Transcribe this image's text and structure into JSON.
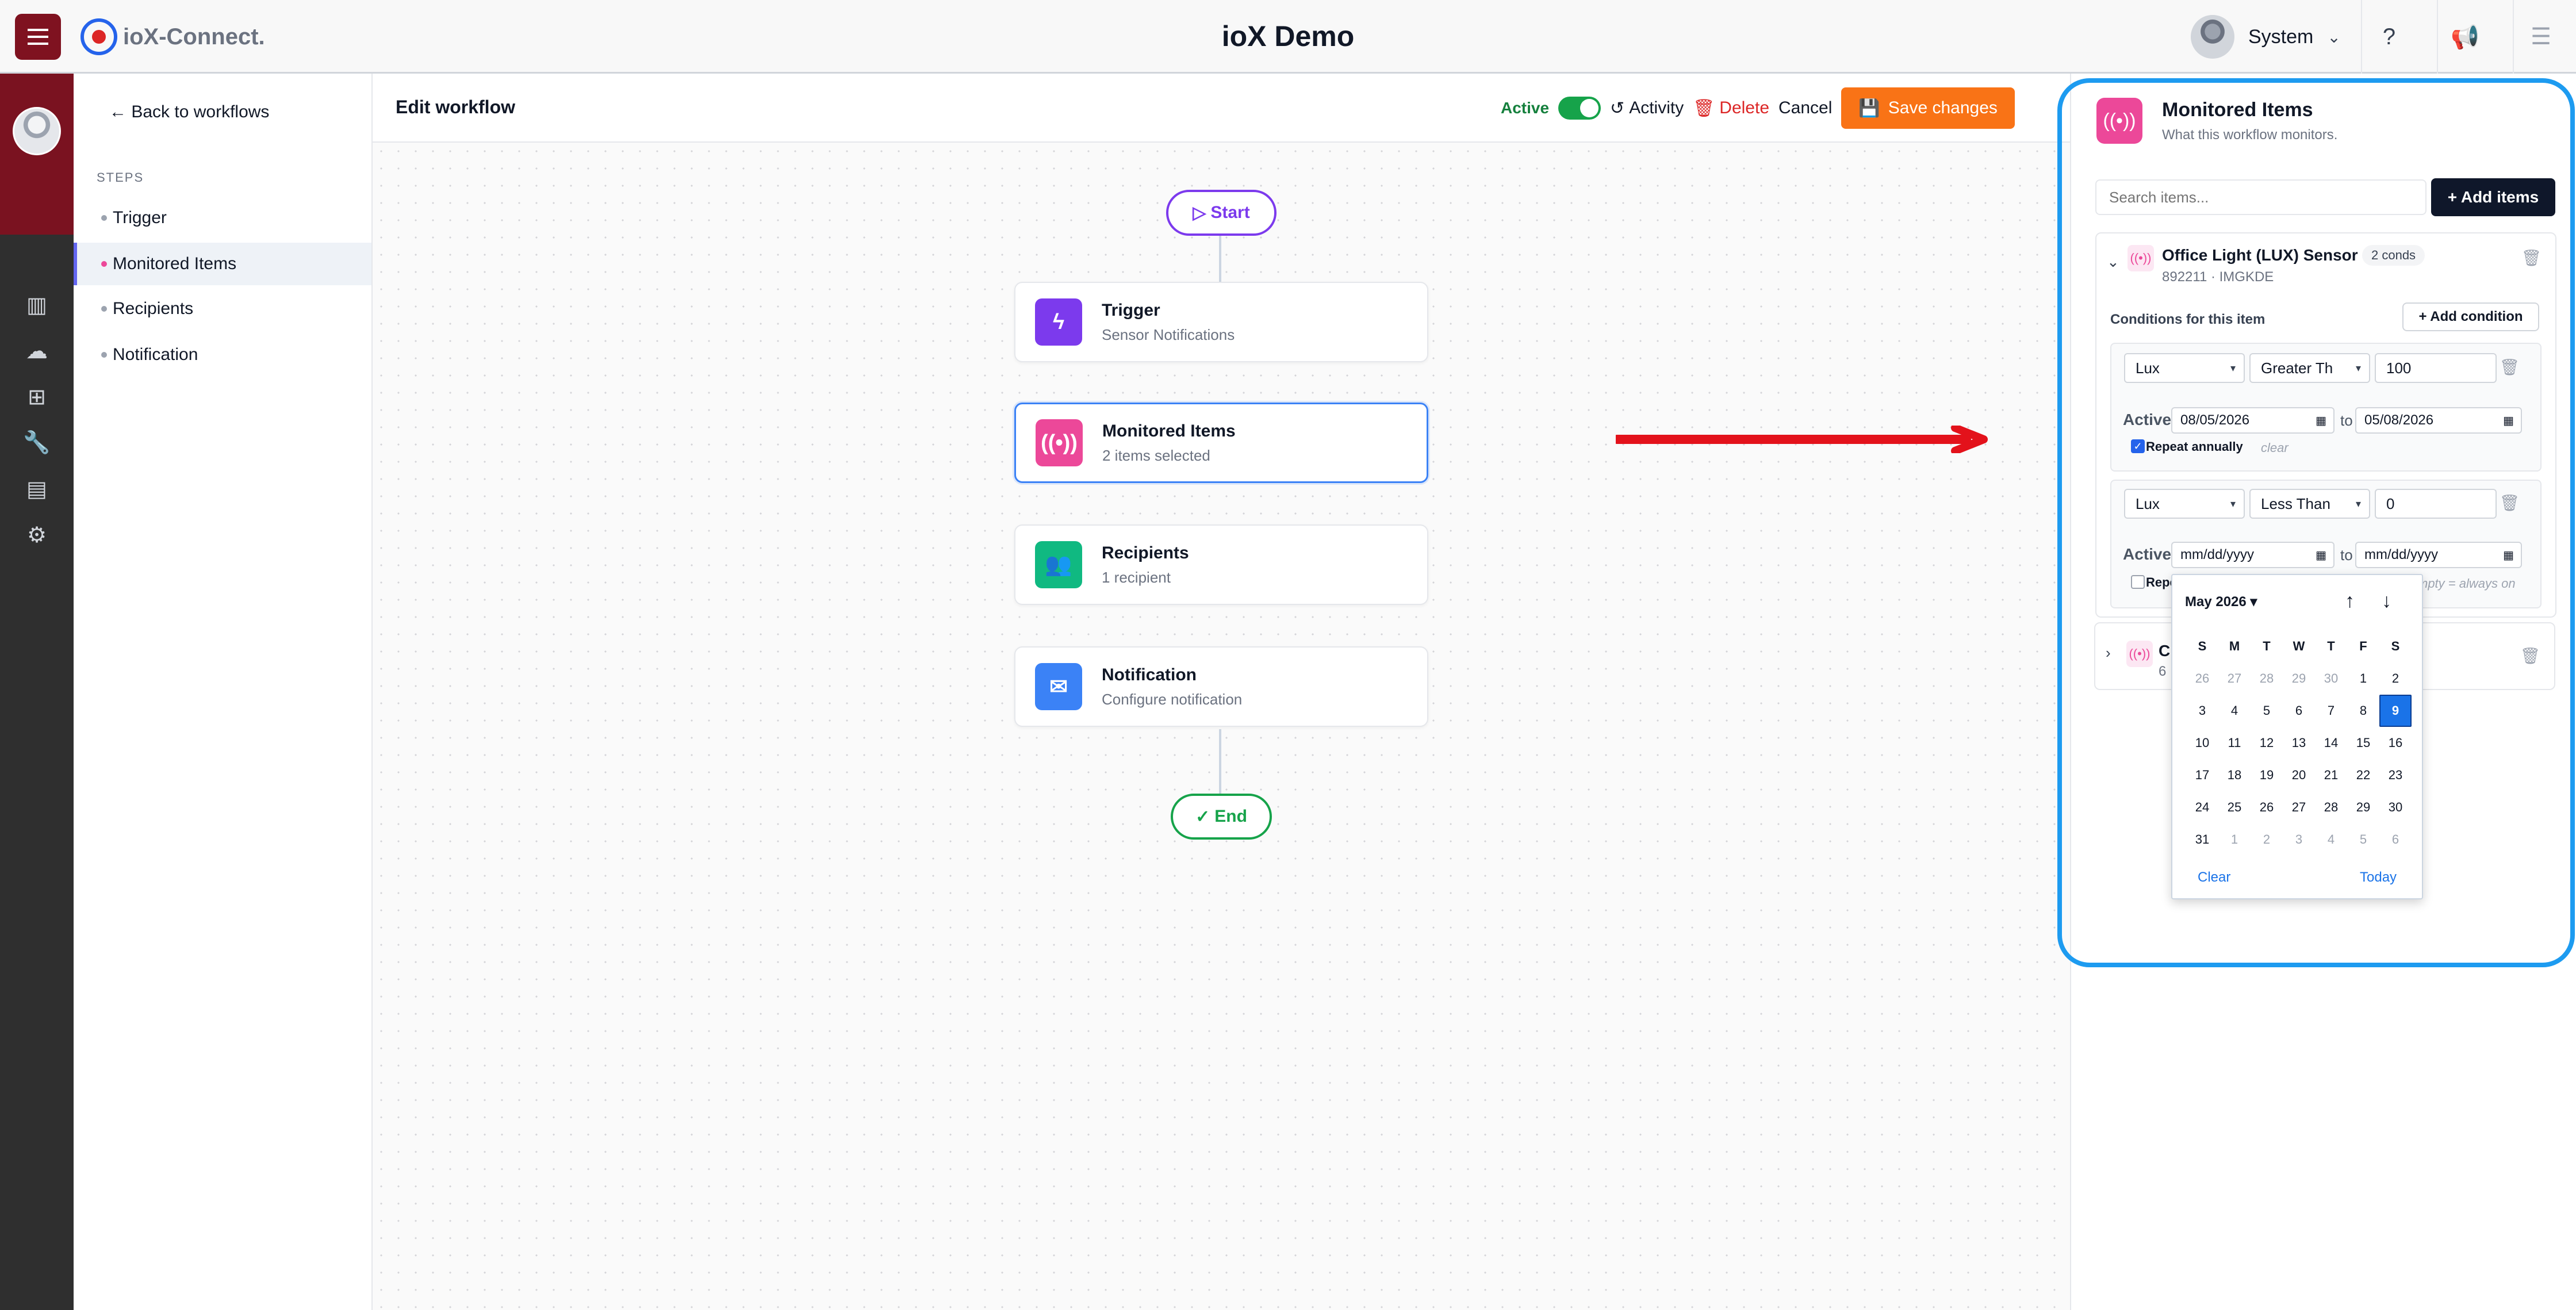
{
  "app": {
    "logo_text": "ioX-Connect.",
    "title": "ioX Demo",
    "user_name": "System"
  },
  "sidebar_nav": {
    "icons": [
      "chart-icon",
      "cloud-icon",
      "hierarchy-icon",
      "wrench-icon",
      "archive-icon",
      "gear-icon"
    ]
  },
  "steps_panel": {
    "back_label": "Back to workflows",
    "heading": "STEPS",
    "items": [
      {
        "label": "Trigger"
      },
      {
        "label": "Monitored Items"
      },
      {
        "label": "Recipients"
      },
      {
        "label": "Notification"
      }
    ]
  },
  "editor": {
    "title": "Edit workflow",
    "active_label": "Active",
    "active_on": true,
    "activity_label": "Activity",
    "delete_label": "Delete",
    "cancel_label": "Cancel",
    "save_label": "Save changes"
  },
  "flow": {
    "start_label": "Start",
    "end_label": "End",
    "nodes": [
      {
        "title": "Trigger",
        "subtitle": "Sensor Notifications",
        "color": "#7c3aed",
        "icon": "bolt-icon"
      },
      {
        "title": "Monitored Items",
        "subtitle": "2 items selected",
        "color": "#ec4899",
        "icon": "broadcast-icon"
      },
      {
        "title": "Recipients",
        "subtitle": "1 recipient",
        "color": "#10b981",
        "icon": "users-icon"
      },
      {
        "title": "Notification",
        "subtitle": "Configure notification",
        "color": "#3b82f6",
        "icon": "mail-icon"
      }
    ]
  },
  "panel": {
    "title": "Monitored Items",
    "subtitle": "What this workflow monitors.",
    "search_placeholder": "Search items...",
    "add_items_label": "+ Add items",
    "item": {
      "name": "Office Light (LUX) Sensor",
      "badge": "2 conds",
      "id_line": "892211 · IMGKDE",
      "conditions_label": "Conditions for this item",
      "add_condition_label": "+ Add condition",
      "conditions": [
        {
          "metric": "Lux",
          "operator": "Greater Th",
          "value": "100",
          "active_label": "Active",
          "from": "08/05/2026",
          "to_label": "to",
          "to": "05/08/2026",
          "repeat_label": "Repeat annually",
          "repeat_checked": true,
          "clear_label": "clear"
        },
        {
          "metric": "Lux",
          "operator": "Less Than",
          "value": "0",
          "active_label": "Active",
          "from": "mm/dd/yyyy",
          "to_label": "to",
          "to": "mm/dd/yyyy",
          "repeat_label": "Repe",
          "repeat_checked": false,
          "hint": "mpty = always on"
        }
      ]
    },
    "collapsed_item": {
      "name_fragment": "C",
      "id_fragment": "6"
    }
  },
  "datepicker": {
    "month_label": "May 2026 ▾",
    "weekdays": [
      "S",
      "M",
      "T",
      "W",
      "T",
      "F",
      "S"
    ],
    "days": [
      {
        "d": "26",
        "muted": true
      },
      {
        "d": "27",
        "muted": true
      },
      {
        "d": "28",
        "muted": true
      },
      {
        "d": "29",
        "muted": true
      },
      {
        "d": "30",
        "muted": true
      },
      {
        "d": "1"
      },
      {
        "d": "2"
      },
      {
        "d": "3"
      },
      {
        "d": "4"
      },
      {
        "d": "5"
      },
      {
        "d": "6"
      },
      {
        "d": "7"
      },
      {
        "d": "8"
      },
      {
        "d": "9",
        "selected": true
      },
      {
        "d": "10"
      },
      {
        "d": "11"
      },
      {
        "d": "12"
      },
      {
        "d": "13"
      },
      {
        "d": "14"
      },
      {
        "d": "15"
      },
      {
        "d": "16"
      },
      {
        "d": "17"
      },
      {
        "d": "18"
      },
      {
        "d": "19"
      },
      {
        "d": "20"
      },
      {
        "d": "21"
      },
      {
        "d": "22"
      },
      {
        "d": "23"
      },
      {
        "d": "24"
      },
      {
        "d": "25"
      },
      {
        "d": "26"
      },
      {
        "d": "27"
      },
      {
        "d": "28"
      },
      {
        "d": "29"
      },
      {
        "d": "30"
      },
      {
        "d": "31"
      },
      {
        "d": "1",
        "muted": true
      },
      {
        "d": "2",
        "muted": true
      },
      {
        "d": "3",
        "muted": true
      },
      {
        "d": "4",
        "muted": true
      },
      {
        "d": "5",
        "muted": true
      },
      {
        "d": "6",
        "muted": true
      }
    ],
    "clear_label": "Clear",
    "today_label": "Today"
  },
  "colors": {
    "brand": "#7f1220",
    "accent": "#f97316",
    "highlight": "#1d9bf0",
    "arrow": "#e3121b"
  }
}
